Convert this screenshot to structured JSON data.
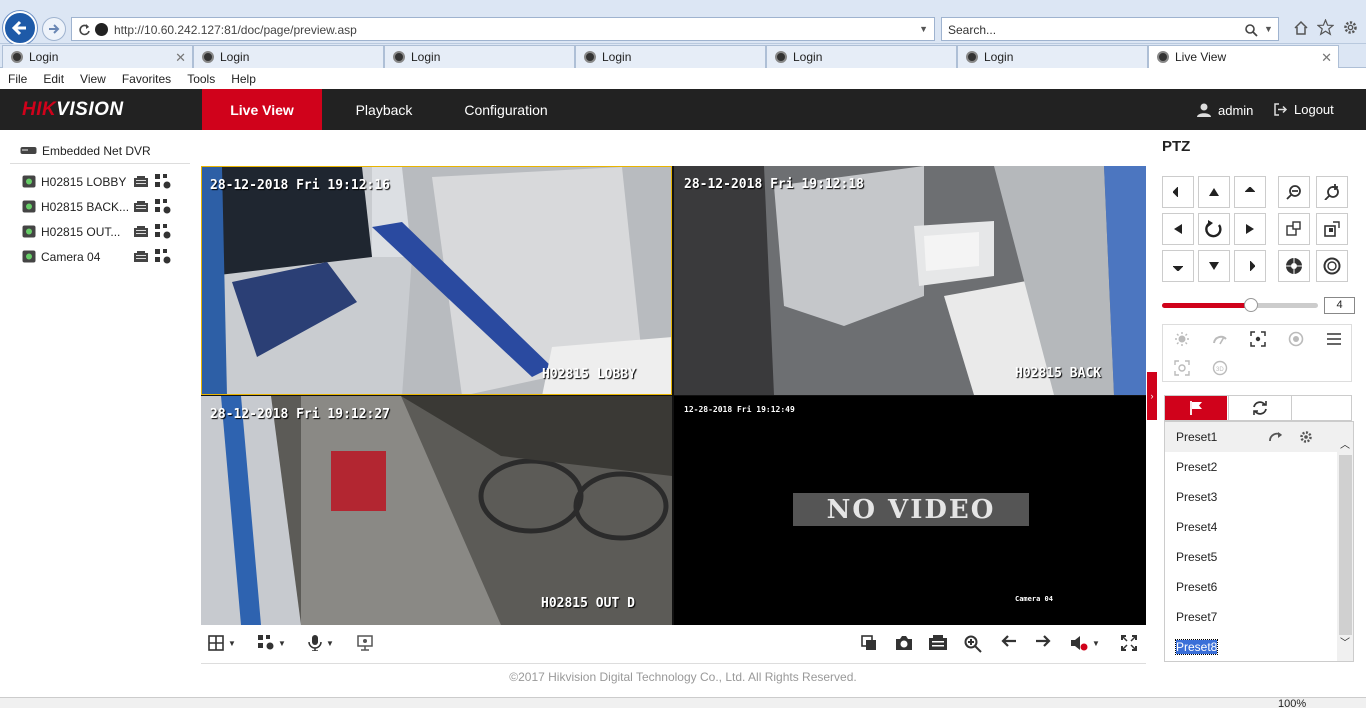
{
  "browser": {
    "url": "http://10.60.242.127:81/doc/page/preview.asp",
    "search_placeholder": "Search...",
    "tabs": [
      {
        "label": "Login"
      },
      {
        "label": "Login"
      },
      {
        "label": "Login"
      },
      {
        "label": "Login"
      },
      {
        "label": "Login"
      },
      {
        "label": "Login"
      },
      {
        "label": "Live View"
      }
    ],
    "menu": [
      "File",
      "Edit",
      "View",
      "Favorites",
      "Tools",
      "Help"
    ],
    "zoom": "100%"
  },
  "header": {
    "logo": {
      "prefix": "HIK",
      "rest": "VISION"
    },
    "nav": [
      "Live View",
      "Playback",
      "Configuration"
    ],
    "active_nav": "Live View",
    "user": "admin",
    "logout": "Logout"
  },
  "sidebar": {
    "device": "Embedded Net DVR",
    "cameras": [
      {
        "label": "H02815 LOBBY"
      },
      {
        "label": "H02815 BACK..."
      },
      {
        "label": "H02815 OUT..."
      },
      {
        "label": "Camera 04"
      }
    ]
  },
  "views": [
    {
      "timestamp": "28-12-2018 Fri 19:12:16",
      "name": "H02815 LOBBY"
    },
    {
      "timestamp": "28-12-2018 Fri 19:12:18",
      "name": "H02815 BACK"
    },
    {
      "timestamp": "28-12-2018 Fri 19:12:27",
      "name": "H02815 OUT D"
    },
    {
      "timestamp": "12-28-2018 Fri 19:12:49",
      "name": "Camera 04",
      "overlay": "NO VIDEO"
    }
  ],
  "footer": "©2017 Hikvision Digital Technology Co., Ltd. All Rights Reserved.",
  "ptz": {
    "title": "PTZ",
    "speed": 4,
    "speed_max": 7,
    "presets": [
      "Preset1",
      "Preset2",
      "Preset3",
      "Preset4",
      "Preset5",
      "Preset6",
      "Preset7",
      "Preset8"
    ],
    "selected_preset": "Preset8"
  },
  "colors": {
    "brand_red": "#d0021b",
    "header_bg": "#222222",
    "ie_blue": "#1e5aa8"
  }
}
